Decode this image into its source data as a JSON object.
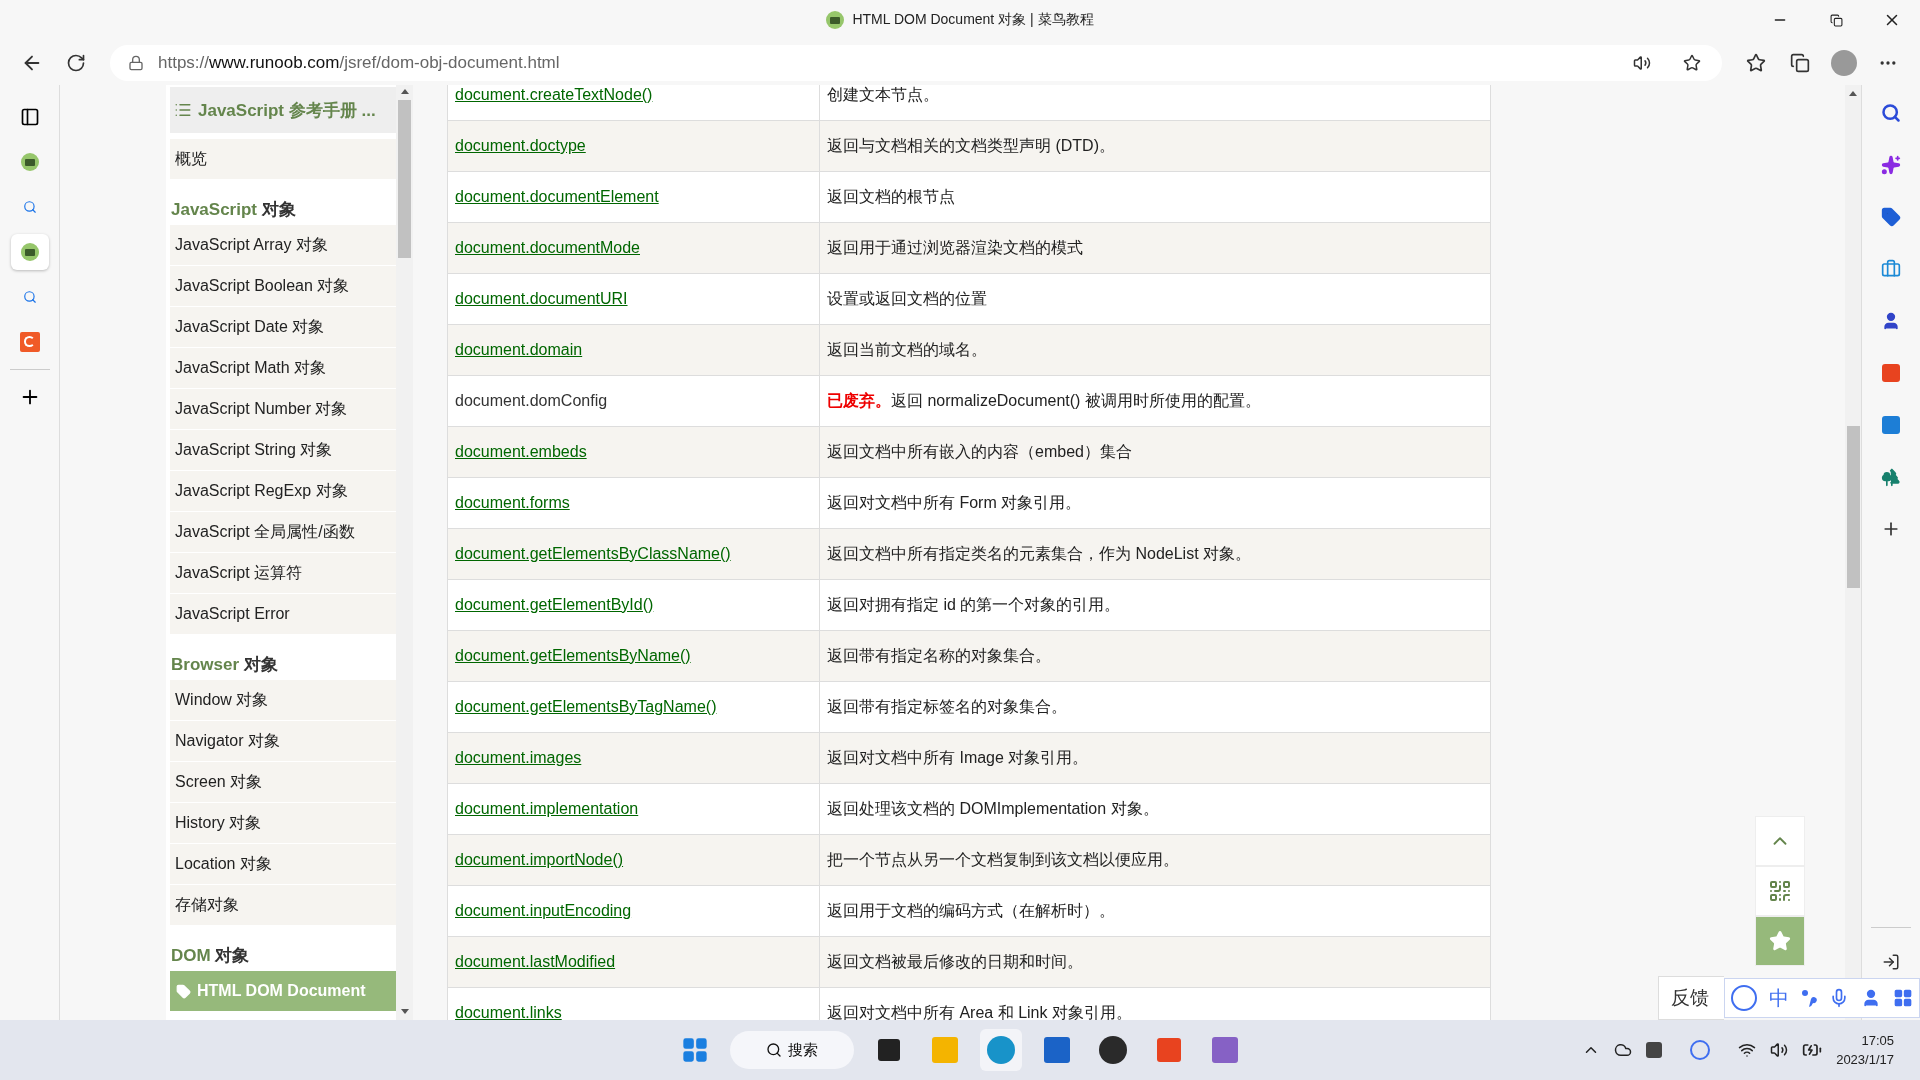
{
  "window": {
    "title": "HTML DOM Document 对象 | 菜鸟教程"
  },
  "address_bar": {
    "scheme": "https://",
    "host": "www.runoob.com",
    "path": "/jsref/dom-obj-document.html"
  },
  "sidebar": {
    "header": "JavaScript 参考手册 ...",
    "sections": [
      {
        "items": [
          {
            "label": "概览",
            "selected": false
          }
        ]
      },
      {
        "heading_accent": "JavaScript",
        "heading_rest": "对象",
        "items": [
          {
            "label": "JavaScript Array 对象",
            "selected": false
          },
          {
            "label": "JavaScript Boolean 对象",
            "selected": false
          },
          {
            "label": "JavaScript Date 对象",
            "selected": false
          },
          {
            "label": "JavaScript Math 对象",
            "selected": false
          },
          {
            "label": "JavaScript Number 对象",
            "selected": false
          },
          {
            "label": "JavaScript String 对象",
            "selected": false
          },
          {
            "label": "JavaScript RegExp 对象",
            "selected": false
          },
          {
            "label": "JavaScript 全局属性/函数",
            "selected": false
          },
          {
            "label": "JavaScript 运算符",
            "selected": false
          },
          {
            "label": "JavaScript Error",
            "selected": false
          }
        ]
      },
      {
        "heading_accent": "Browser",
        "heading_rest": "对象",
        "items": [
          {
            "label": "Window 对象",
            "selected": false
          },
          {
            "label": "Navigator 对象",
            "selected": false
          },
          {
            "label": "Screen 对象",
            "selected": false
          },
          {
            "label": "History 对象",
            "selected": false
          },
          {
            "label": "Location 对象",
            "selected": false
          },
          {
            "label": "存储对象",
            "selected": false
          }
        ]
      },
      {
        "heading_accent": "DOM",
        "heading_rest": "对象",
        "items": [
          {
            "label": "HTML DOM Document",
            "selected": true
          }
        ]
      }
    ]
  },
  "table": {
    "rows": [
      {
        "name": "document.createTextNode()",
        "link": true,
        "description": "创建文本节点。"
      },
      {
        "name": "document.doctype",
        "link": true,
        "description": "返回与文档相关的文档类型声明 (DTD)。"
      },
      {
        "name": "document.documentElement",
        "link": true,
        "description": "返回文档的根节点"
      },
      {
        "name": "document.documentMode",
        "link": true,
        "description": "返回用于通过浏览器渲染文档的模式"
      },
      {
        "name": "document.documentURI",
        "link": true,
        "description": "设置或返回文档的位置"
      },
      {
        "name": "document.domain",
        "link": true,
        "description": "返回当前文档的域名。"
      },
      {
        "name": "document.domConfig",
        "link": false,
        "warning": "已废弃。",
        "description": "返回 normalizeDocument() 被调用时所使用的配置。"
      },
      {
        "name": "document.embeds",
        "link": true,
        "description": "返回文档中所有嵌入的内容（embed）集合"
      },
      {
        "name": "document.forms",
        "link": true,
        "description": "返回对文档中所有 Form 对象引用。"
      },
      {
        "name": "document.getElementsByClassName()",
        "link": true,
        "description": "返回文档中所有指定类名的元素集合，作为 NodeList 对象。"
      },
      {
        "name": "document.getElementById()",
        "link": true,
        "description": "返回对拥有指定 id 的第一个对象的引用。"
      },
      {
        "name": "document.getElementsByName()",
        "link": true,
        "description": "返回带有指定名称的对象集合。"
      },
      {
        "name": "document.getElementsByTagName()",
        "link": true,
        "description": "返回带有指定标签名的对象集合。"
      },
      {
        "name": "document.images",
        "link": true,
        "description": "返回对文档中所有 Image 对象引用。"
      },
      {
        "name": "document.implementation",
        "link": true,
        "description": "返回处理该文档的 DOMImplementation 对象。"
      },
      {
        "name": "document.importNode()",
        "link": true,
        "description": "把一个节点从另一个文档复制到该文档以便应用。"
      },
      {
        "name": "document.inputEncoding",
        "link": true,
        "description": "返回用于文档的编码方式（在解析时）。"
      },
      {
        "name": "document.lastModified",
        "link": true,
        "description": "返回文档被最后修改的日期和时间。"
      },
      {
        "name": "document.links",
        "link": true,
        "description": "返回对文档中所有 Area 和 Link 对象引用。"
      }
    ]
  },
  "feedback": "反馈",
  "ime": {
    "mode": "中"
  },
  "taskbar": {
    "search": "搜索",
    "time": "17:05",
    "date": "2023/1/17"
  }
}
